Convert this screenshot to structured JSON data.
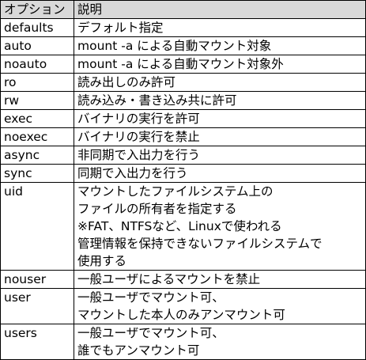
{
  "table": {
    "header": {
      "option": "オプション",
      "description": "説明"
    },
    "rows": [
      {
        "option": "defaults",
        "lines": [
          "デフォルト指定"
        ]
      },
      {
        "option": "auto",
        "lines": [
          "mount -a による自動マウント対象"
        ]
      },
      {
        "option": "noauto",
        "lines": [
          "mount -a による自動マウント対象外"
        ]
      },
      {
        "option": "ro",
        "lines": [
          "読み出しのみ許可"
        ]
      },
      {
        "option": "rw",
        "lines": [
          "読み込み・書き込み共に許可"
        ]
      },
      {
        "option": "exec",
        "lines": [
          "バイナリの実行を許可"
        ]
      },
      {
        "option": "noexec",
        "lines": [
          "バイナリの実行を禁止"
        ]
      },
      {
        "option": "async",
        "lines": [
          "非同期で入出力を行う"
        ]
      },
      {
        "option": "sync",
        "lines": [
          "同期で入出力を行う"
        ]
      },
      {
        "option": "uid",
        "lines": [
          "マウントしたファイルシステム上の",
          "ファイルの所有者を指定する",
          "※FAT、NTFSなど、Linuxで使われる",
          "管理情報を保持できないファイルシステムで",
          "使用する"
        ]
      },
      {
        "option": "nouser",
        "lines": [
          "一般ユーザによるマウントを禁止"
        ]
      },
      {
        "option": "user",
        "lines": [
          "一般ユーザでマウント可、",
          "マウントした本人のみアンマウント可"
        ]
      },
      {
        "option": "users",
        "lines": [
          "一般ユーザでマウント可、",
          "誰でもアンマウント可"
        ]
      }
    ]
  }
}
